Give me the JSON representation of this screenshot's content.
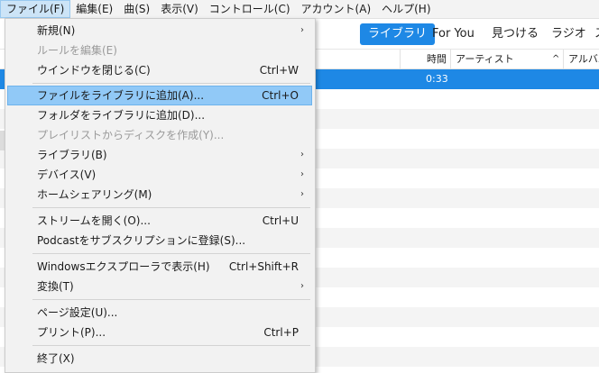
{
  "menubar": {
    "items": [
      {
        "label": "ファイル(F)"
      },
      {
        "label": "編集(E)"
      },
      {
        "label": "曲(S)"
      },
      {
        "label": "表示(V)"
      },
      {
        "label": "コントロール(C)"
      },
      {
        "label": "アカウント(A)"
      },
      {
        "label": "ヘルプ(H)"
      }
    ]
  },
  "nav": {
    "tabs": [
      {
        "label": "ライブラリ"
      },
      {
        "label": "For You"
      },
      {
        "label": "見つける"
      },
      {
        "label": "ラジオ"
      },
      {
        "label": "ス"
      }
    ]
  },
  "columns": {
    "time": "時間",
    "artist": "アーティスト",
    "sort_indicator": "^",
    "album": "アルバム"
  },
  "rows": {
    "selected_time": "0:33"
  },
  "file_menu": {
    "items": [
      {
        "label": "新規(N)",
        "shortcut": "",
        "submenu": true,
        "disabled": false
      },
      {
        "label": "ルールを編集(E)",
        "shortcut": "",
        "submenu": false,
        "disabled": true
      },
      {
        "label": "ウインドウを閉じる(C)",
        "shortcut": "Ctrl+W",
        "submenu": false,
        "disabled": false
      },
      {
        "label": "ファイルをライブラリに追加(A)...",
        "shortcut": "Ctrl+O",
        "submenu": false,
        "disabled": false,
        "highlighted": true
      },
      {
        "label": "フォルダをライブラリに追加(D)...",
        "shortcut": "",
        "submenu": false,
        "disabled": false
      },
      {
        "label": "プレイリストからディスクを作成(Y)...",
        "shortcut": "",
        "submenu": false,
        "disabled": true
      },
      {
        "label": "ライブラリ(B)",
        "shortcut": "",
        "submenu": true,
        "disabled": false
      },
      {
        "label": "デバイス(V)",
        "shortcut": "",
        "submenu": true,
        "disabled": false
      },
      {
        "label": "ホームシェアリング(M)",
        "shortcut": "",
        "submenu": true,
        "disabled": false
      },
      {
        "label": "ストリームを開く(O)...",
        "shortcut": "Ctrl+U",
        "submenu": false,
        "disabled": false
      },
      {
        "label": "Podcastをサブスクリプションに登録(S)...",
        "shortcut": "",
        "submenu": false,
        "disabled": false
      },
      {
        "label": "Windowsエクスプローラで表示(H)",
        "shortcut": "Ctrl+Shift+R",
        "submenu": false,
        "disabled": false
      },
      {
        "label": "変換(T)",
        "shortcut": "",
        "submenu": true,
        "disabled": false
      },
      {
        "label": "ページ設定(U)...",
        "shortcut": "",
        "submenu": false,
        "disabled": false
      },
      {
        "label": "プリント(P)...",
        "shortcut": "Ctrl+P",
        "submenu": false,
        "disabled": false
      },
      {
        "label": "終了(X)",
        "shortcut": "",
        "submenu": false,
        "disabled": false
      }
    ],
    "submenu_glyph": "›"
  },
  "colors": {
    "accent": "#1e88e5",
    "menu_highlight": "#91c9f7",
    "menu_bg": "#f2f2f2",
    "disabled_text": "#9a9a9a"
  }
}
